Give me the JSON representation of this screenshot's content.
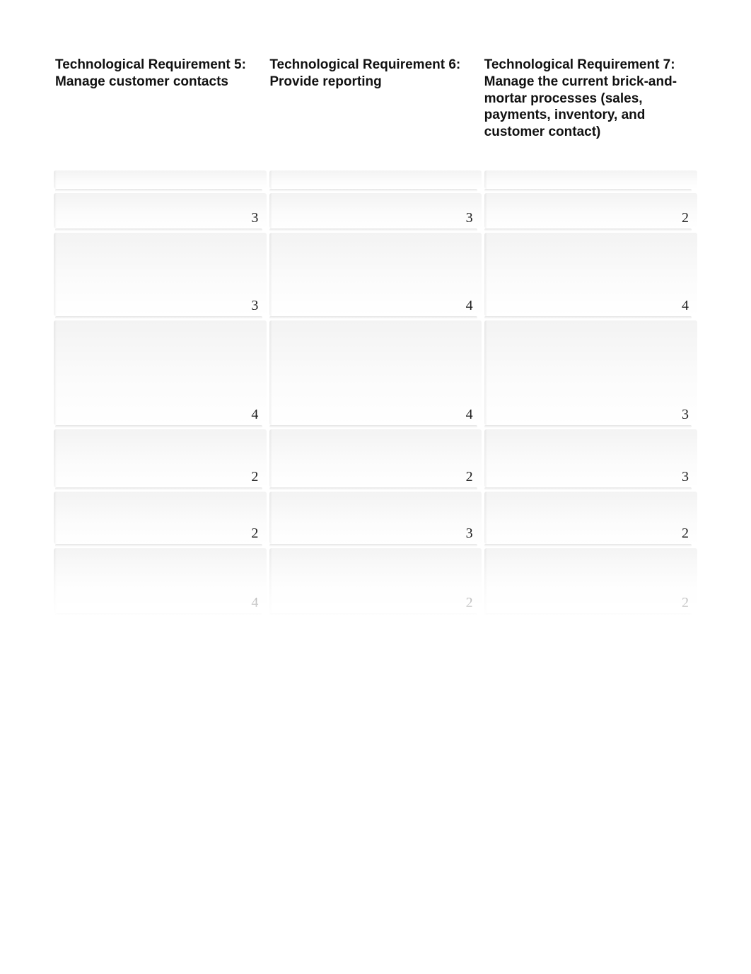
{
  "table": {
    "headers": [
      "Technological Requirement 5: Manage customer contacts",
      "Technological Requirement 6: Provide reporting",
      "Technological Requirement 7: Manage the current brick-and-mortar processes (sales, payments, inventory, and customer contact)"
    ],
    "rows": [
      {
        "c1": "",
        "c2": "",
        "c3": ""
      },
      {
        "c1": "3",
        "c2": "3",
        "c3": "2"
      },
      {
        "c1": "3",
        "c2": "4",
        "c3": "4"
      },
      {
        "c1": "4",
        "c2": "4",
        "c3": "3"
      },
      {
        "c1": "2",
        "c2": "2",
        "c3": "3"
      },
      {
        "c1": "2",
        "c2": "3",
        "c3": "2"
      },
      {
        "c1": "4",
        "c2": "2",
        "c3": "2"
      }
    ]
  }
}
